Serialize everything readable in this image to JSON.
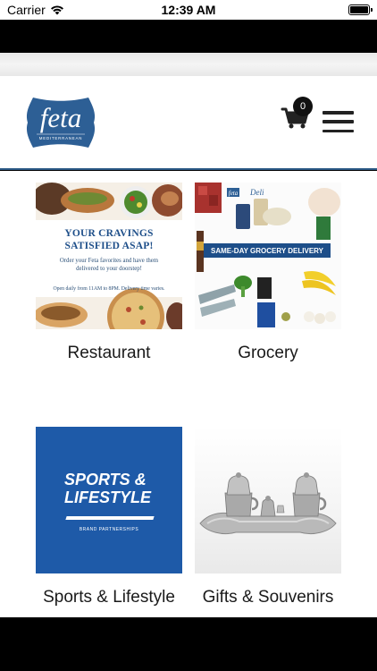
{
  "status_bar": {
    "carrier": "Carrier",
    "time": "12:39 AM"
  },
  "header": {
    "logo_text": "feta",
    "logo_sub": "MEDITERRANEAN",
    "cart_count": "0",
    "accent_color": "#2c5a86"
  },
  "categories": [
    {
      "label": "Restaurant",
      "image": {
        "headline_1": "YOUR CRAVINGS",
        "headline_2": "SATISFIED ASAP!",
        "body_1": "Order your Feta favorites and have them",
        "body_2": "delivered to your doorstep!",
        "hours": "Open daily from 11AM to 8PM. Delivery time varies."
      }
    },
    {
      "label": "Grocery",
      "image": {
        "brand": "feta",
        "script": "Deli",
        "banner": "SAME-DAY GROCERY DELIVERY"
      }
    },
    {
      "label": "Sports & Lifestyle",
      "image": {
        "line_1": "SPORTS &",
        "line_2": "LIFESTYLE",
        "small": "BRAND PARTNERSHIPS"
      }
    },
    {
      "label": "Gifts & Souvenirs",
      "image": {}
    }
  ]
}
